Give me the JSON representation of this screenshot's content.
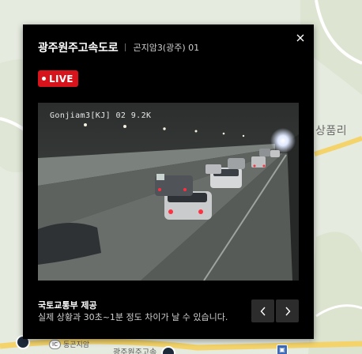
{
  "popup": {
    "title": "광주원주고속도로",
    "subtitle": "곤지암3(광주) 01",
    "live_badge": "LIVE",
    "video_overlay": "Gonjiam3[KJ] 02 9.2K",
    "provider": "국토교통부 제공",
    "notice": "실제 상황과 30초~1분 정도 차이가 날 수 있습니다.",
    "close_icon": "close-icon",
    "prev_icon": "chevron-left-icon",
    "next_icon": "chevron-right-icon"
  },
  "map": {
    "place_label": "상품리",
    "ic_badge": "IC",
    "ic_label": "동곤지암",
    "road_label": "광주원주고속"
  },
  "colors": {
    "popup_bg": "#000000",
    "live_red": "#d7131b",
    "map_bg": "#e6ebe0",
    "highway_yellow": "#f3d36a"
  }
}
